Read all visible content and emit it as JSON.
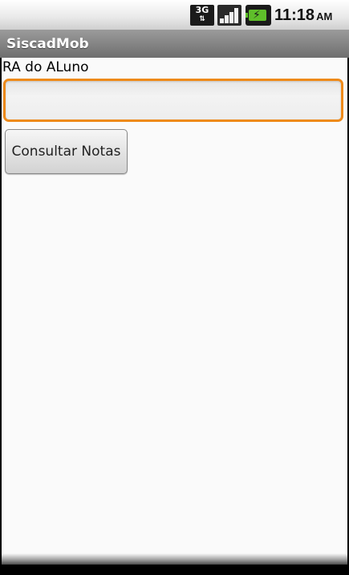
{
  "status_bar": {
    "network_type": "3G",
    "network_arrows": "⇅",
    "signal_icon": "signal-strength-icon",
    "battery_icon": "battery-charging-icon",
    "time": "11:18",
    "ampm": "AM"
  },
  "app": {
    "title": "SiscadMob"
  },
  "form": {
    "ra_label": "RA do ALuno",
    "ra_value": "",
    "submit_label": "Consultar Notas"
  },
  "colors": {
    "focus_border": "#ee8a1a",
    "title_bar": "#7a7a7a",
    "background": "#fafafa"
  }
}
